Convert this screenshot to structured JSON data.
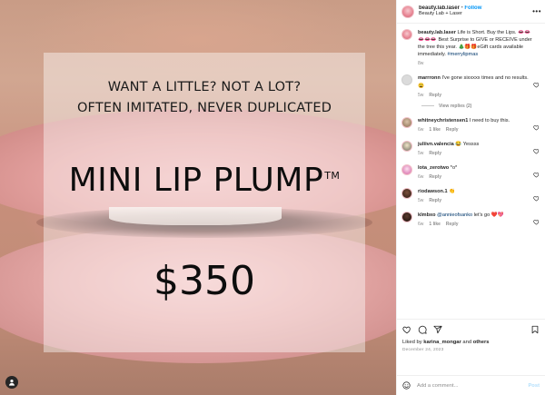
{
  "post": {
    "username": "beauty.lab.laser",
    "follow_label": "Follow",
    "separator": "•",
    "location": "Beauty Lab + Laser"
  },
  "image": {
    "tagline_1": "WANT A LITTLE? NOT A LOT?",
    "tagline_2": "OFTEN IMITATED, NEVER DUPLICATED",
    "product": "MINI LIP PLUMP",
    "trademark": "TM",
    "price": "$350"
  },
  "caption": {
    "username": "beauty.lab.laser",
    "text": "Life is Short. Buy the Lips. 👄👄👄👄👄 Best Surprise to GIVE or RECEIVE under the tree this year. 🎄🎁🎁eGift cards available immediately.",
    "hashtag": "#merrylipmas",
    "time": "8w"
  },
  "comments": [
    {
      "username": "marrronn",
      "text": "I've gone sixxxxx times and no results. 😩",
      "time": "5w",
      "likes": "",
      "reply": "Reply",
      "view_replies": "View replies (2)"
    },
    {
      "username": "whitneychristensen1",
      "text": "I need to buy this.",
      "time": "6w",
      "likes": "1 like",
      "reply": "Reply"
    },
    {
      "username": "juliivn.valencia",
      "text": "😂 Yessss",
      "time": "5w",
      "likes": "",
      "reply": "Reply"
    },
    {
      "username": "lota_zerotwo",
      "text": "*o*",
      "time": "6w",
      "likes": "",
      "reply": "Reply"
    },
    {
      "username": "riodawson.1",
      "text": "👏",
      "time": "5w",
      "likes": "",
      "reply": "Reply"
    },
    {
      "username": "klmbxo",
      "mention": "@annieofsanko",
      "text": "let's go ❤️💖",
      "time": "6w",
      "likes": "1 like",
      "reply": "Reply"
    }
  ],
  "actions": {
    "liked_prefix": "Liked by",
    "liked_user": "karina_mongar",
    "liked_and": "and",
    "liked_others": "others",
    "date": "December 24, 2023"
  },
  "add_comment": {
    "placeholder": "Add a comment...",
    "post_label": "Post"
  },
  "icons": {
    "more": "more-icon",
    "like": "heart-icon",
    "comment": "comment-icon",
    "share": "share-icon",
    "save": "bookmark-icon",
    "emoji": "emoji-icon",
    "tagged": "user-tag-icon"
  },
  "colors": {
    "link_blue": "#0095f6",
    "text": "#262626",
    "muted": "#8e8e8e"
  }
}
